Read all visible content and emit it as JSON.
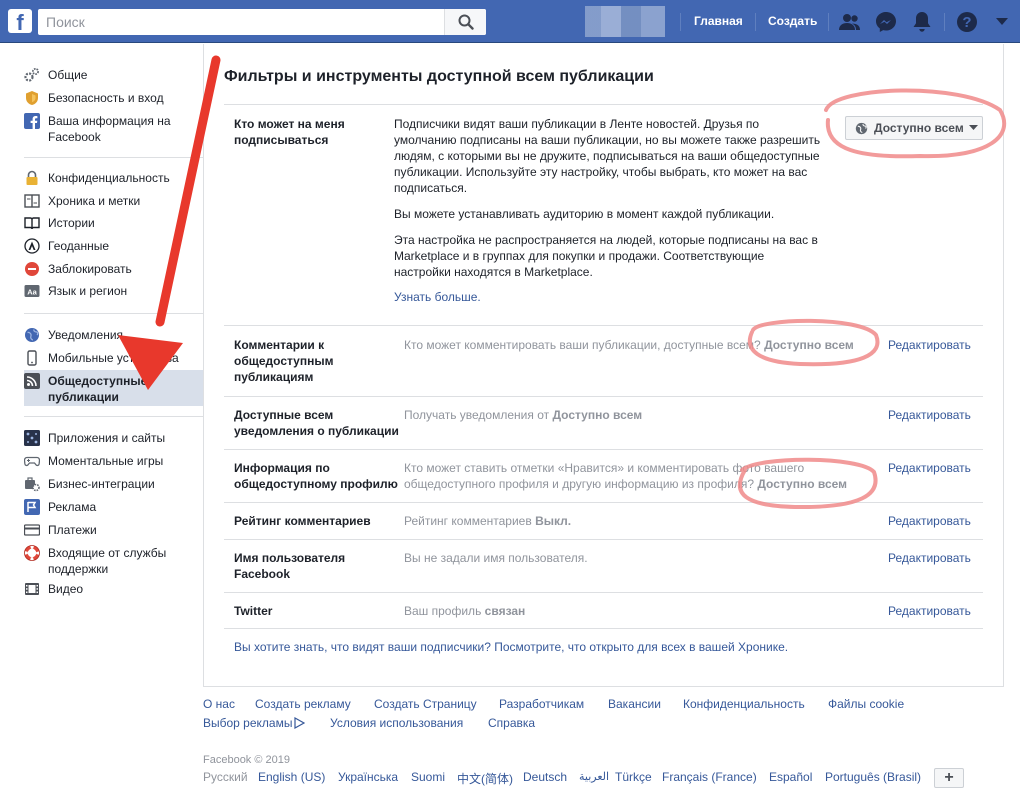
{
  "header": {
    "search_placeholder": "Поиск",
    "home": "Главная",
    "create": "Создать",
    "brand_color": "#4267b2"
  },
  "sidebar": {
    "group1": [
      "Общие",
      "Безопасность и вход",
      "Ваша информация на Facebook"
    ],
    "group2": [
      "Конфиденциальность",
      "Хроника и метки",
      "Истории",
      "Геоданные",
      "Заблокировать",
      "Язык и регион"
    ],
    "group3": [
      "Уведомления",
      "Мобильные устройства",
      "Общедоступные публикации"
    ],
    "group4": [
      "Приложения и сайты",
      "Моментальные игры",
      "Бизнес-интеграции",
      "Реклама",
      "Платежи",
      "Входящие от службы поддержки",
      "Видео"
    ]
  },
  "main": {
    "title": "Фильтры и инструменты доступной всем публикации",
    "follow": {
      "label": "Кто может на меня подписываться",
      "p1": "Подписчики видят ваши публикации в Ленте новостей. Друзья по умолчанию подписаны на ваши публикации, но вы можете также разрешить людям, с которыми вы не дружите, подписываться на ваши общедоступные публикации. Используйте эту настройку, чтобы выбрать, кто может на вас подписаться.",
      "p2": "Вы можете устанавливать аудиторию в момент каждой публикации.",
      "p3": "Эта настройка не распространяется на людей, которые подписаны на вас в Marketplace и в группах для покупки и продажи. Соответствующие настройки находятся в Marketplace.",
      "learn_more": "Узнать больше.",
      "audience": "Доступно всем"
    },
    "rows": [
      {
        "label": "Комментарии к общедоступным публикациям",
        "desc": "Кто может комментировать ваши публикации, доступные всем?",
        "value": "Доступно всем",
        "edit": "Редактировать"
      },
      {
        "label": "Доступные всем уведомления о публикации",
        "desc": "Получать уведомления от",
        "value": "Доступно всем",
        "edit": "Редактировать"
      },
      {
        "label": "Информация по общедоступному профилю",
        "desc": "Кто может ставить отметки «Нравится» и комментировать фото вашего",
        "desc2": "общедоступного профиля и другую информацию из профиля?",
        "value": "Доступно всем",
        "edit": "Редактировать"
      },
      {
        "label": "Рейтинг комментариев",
        "desc": "Рейтинг комментариев",
        "value": "Выкл.",
        "edit": "Редактировать"
      },
      {
        "label": "Имя пользователя Facebook",
        "desc": "Вы не задали имя пользователя.",
        "value": "",
        "edit": "Редактировать"
      },
      {
        "label": "Twitter",
        "desc": "Ваш профиль",
        "value": "связан",
        "edit": "Редактировать"
      }
    ],
    "followers_question": "Вы хотите знать, что видят ваши подписчики? Посмотрите, что открыто для всех в вашей Хронике."
  },
  "footer": {
    "links1": [
      "О нас",
      "Создать рекламу",
      "Создать Страницу",
      "Разработчикам",
      "Вакансии",
      "Конфиденциальность",
      "Файлы cookie"
    ],
    "links2": [
      "Выбор рекламы",
      "Условия использования",
      "Справка"
    ],
    "copyright": "Facebook © 2019",
    "languages": [
      "Русский",
      "English (US)",
      "Українська",
      "Suomi",
      "中文(简体)",
      "Deutsch",
      "العربية",
      "Türkçe",
      "Français (France)",
      "Español",
      "Português (Brasil)"
    ],
    "more_languages": "+"
  }
}
